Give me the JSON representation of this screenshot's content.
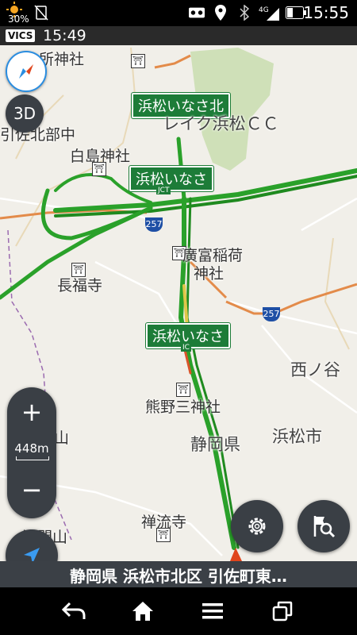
{
  "status_bar": {
    "battery_percent": "30%",
    "time": "15:55",
    "network": "4G",
    "icons": [
      "weather-sun-icon",
      "no-sim-icon",
      "voicemail-icon",
      "location-pin-icon",
      "bluetooth-icon",
      "signal-icon",
      "battery-icon"
    ]
  },
  "vics_bar": {
    "badge": "VICS",
    "time": "15:49"
  },
  "map": {
    "labels": {
      "shrine_top": "六所神社",
      "reiku": "レイク浜松ＣＣ",
      "shirotori": "白島神社",
      "kitabu": "引佐北部中",
      "chofukuji": "長福寺",
      "tomisaka": "廣富稲荷",
      "tomisaka2": "神社",
      "nishinoya": "西ノ谷",
      "kumano": "熊野三神社",
      "shizuoka": "静岡県",
      "hamamatsu": "浜松市",
      "asamayama": "浅間山",
      "zenryuji": "禅流寺",
      "asamayama2": "浅間山"
    },
    "signs": {
      "kita": "浜松いなさ北",
      "jct": "浜松いなさ",
      "ic": "浜松いなさ"
    },
    "sign_badges": {
      "jct": "JCT",
      "ic": "IC"
    },
    "route_shields": {
      "r257a": "257",
      "r257b": "257"
    }
  },
  "controls": {
    "view_3d": "3D",
    "zoom_scale": "448m",
    "zoom_in": "+",
    "zoom_out": "−"
  },
  "address_bar": {
    "text": "静岡県 浜松市北区 引佐町東…"
  },
  "colors": {
    "expressway": "#2aa12a",
    "road_orange": "#e38b4a",
    "accent_blue": "#1a73c9"
  }
}
